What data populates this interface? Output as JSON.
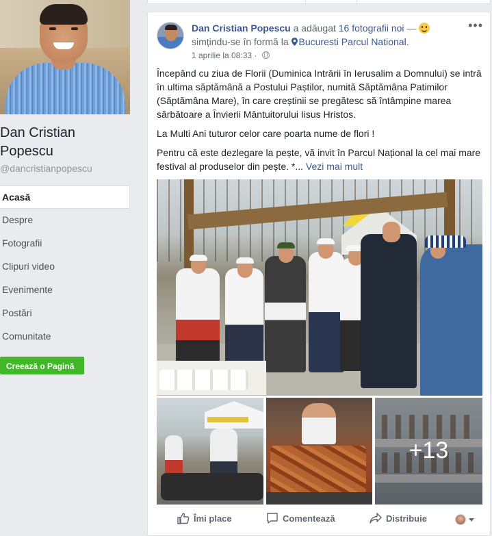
{
  "profile": {
    "name": "Dan Cristian Popescu",
    "username": "@dancristianpopescu"
  },
  "nav": {
    "items": [
      {
        "label": "Acasă",
        "active": true
      },
      {
        "label": "Despre"
      },
      {
        "label": "Fotografii"
      },
      {
        "label": "Clipuri video"
      },
      {
        "label": "Evenimente"
      },
      {
        "label": "Postări"
      },
      {
        "label": "Comunitate"
      }
    ],
    "create_page_label": "Creează o Pagină"
  },
  "post": {
    "author": "Dan Cristian Popescu",
    "action_text": " a adăugat ",
    "photos_count_text": "16 fotografii noi",
    "dash": " — ",
    "feeling_text": "simțindu-se în formă la ",
    "location": "Bucuresti Parcul National",
    "location_suffix": ".",
    "timestamp": "1 aprilie la 08:33",
    "timestamp_sep": " · ",
    "paragraphs": [
      "Începând cu ziua de Florii (Duminica Intrării în Ierusalim a Domnului) se intră în ultima săptămână a Postului Paștilor, numită Săptămâna Patimilor (Săptămâna Mare), în care creștinii se pregătesc să întâmpine marea sărbătoare a Învierii Mântuitorului Iisus Hristos.",
      "La Multi Ani tuturor celor care poarta nume de flori !"
    ],
    "last_paragraph": "Pentru că este dezlegare la pește, vă invit în Parcul Național la cel mai mare festival al produselor din pește. *...",
    "see_more": "Vezi mai mult",
    "more_photos": "+13"
  },
  "actions": {
    "like": "Îmi place",
    "comment": "Comentează",
    "share": "Distribuie"
  },
  "colors": {
    "link": "#385898",
    "background": "#e9ebee",
    "create_button": "#42b72a"
  }
}
